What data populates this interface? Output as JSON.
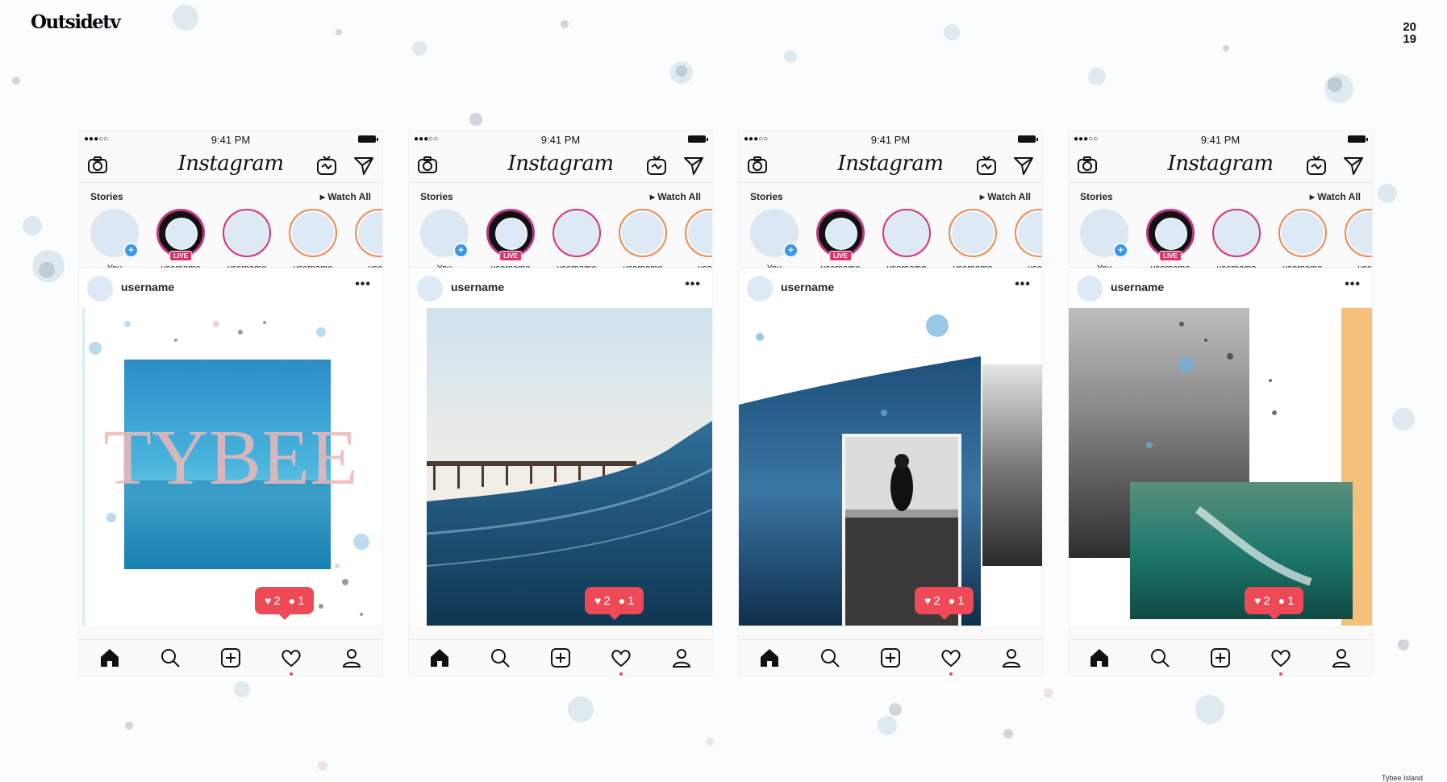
{
  "brand": {
    "logo_text": "Outsidetv",
    "year_top": "20",
    "year_bottom": "19"
  },
  "footer": {
    "text": "Tybee Island"
  },
  "phones": [
    {
      "id": "phone-1",
      "post_title_overlay": "TYBEE"
    },
    {
      "id": "phone-2",
      "post_title_overlay": ""
    },
    {
      "id": "phone-3",
      "post_title_overlay": ""
    },
    {
      "id": "phone-4",
      "post_title_overlay": ""
    }
  ],
  "common": {
    "status": {
      "signal": "●●●○○",
      "time": "9:41 PM"
    },
    "app_title": "Instagram",
    "stories_title": "Stories",
    "watch_all": "▸ Watch All",
    "stories": [
      {
        "name": "You",
        "type": "you",
        "plus": "+"
      },
      {
        "name": "username",
        "type": "live",
        "badge": "LIVE"
      },
      {
        "name": "username",
        "type": "normal"
      },
      {
        "name": "username",
        "type": "normal"
      },
      {
        "name": "usern",
        "type": "normal"
      }
    ],
    "post_user": "username",
    "more": "•••",
    "likes": "2",
    "comments": "1"
  },
  "colors": {
    "accent_red": "#ed4956",
    "story_ring": "#e1306c",
    "blue_plus": "#3897f0",
    "orange_stripe": "#f5c07a"
  },
  "icons": {
    "status": [
      "signal-dots-icon",
      "battery-icon"
    ],
    "header": [
      "camera-icon",
      "igtv-icon",
      "direct-send-icon"
    ],
    "tabs": [
      "home-icon",
      "search-icon",
      "add-post-icon",
      "activity-heart-icon",
      "profile-icon"
    ]
  }
}
